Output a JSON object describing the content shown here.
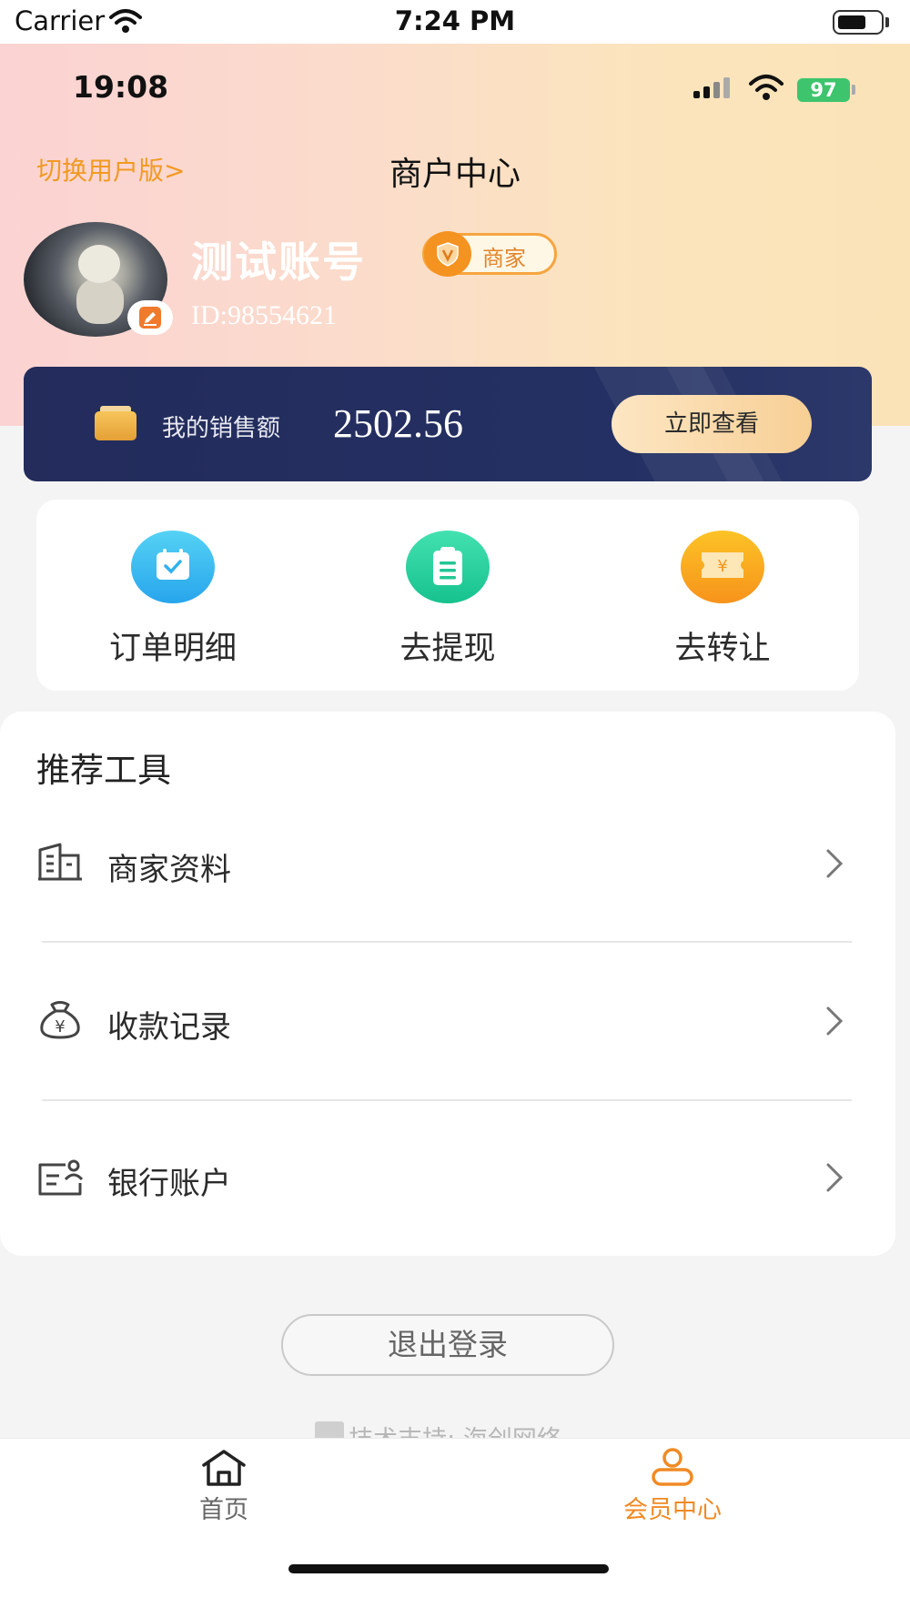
{
  "ios_status": {
    "carrier": "Carrier",
    "time": "7:24 PM"
  },
  "inner_status": {
    "time": "19:08",
    "battery": "97"
  },
  "header": {
    "switch_link": "切换用户版>",
    "title": "商户中心"
  },
  "profile": {
    "username": "测试账号",
    "user_id": "ID:98554621",
    "badge": "商家"
  },
  "sales": {
    "label": "我的销售额",
    "amount": "2502.56",
    "button": "立即查看"
  },
  "actions": [
    {
      "label": "订单明细",
      "icon": "order-calendar-icon",
      "color": "#27a5ec"
    },
    {
      "label": "去提现",
      "icon": "withdraw-clipboard-icon",
      "color": "#16c28e"
    },
    {
      "label": "去转让",
      "icon": "transfer-ticket-icon",
      "color": "#f7931b"
    }
  ],
  "tools": {
    "title": "推荐工具",
    "items": [
      {
        "label": "商家资料",
        "icon": "building-icon"
      },
      {
        "label": "收款记录",
        "icon": "money-bag-icon"
      },
      {
        "label": "银行账户",
        "icon": "bank-card-icon"
      }
    ]
  },
  "logout": "退出登录",
  "support": "技术支持: 海创网络",
  "bottom_nav": {
    "items": [
      {
        "label": "首页",
        "icon": "home-icon",
        "active": false
      },
      {
        "label": "会员中心",
        "icon": "member-icon",
        "active": true
      }
    ],
    "active_color": "#f08a24"
  },
  "colors": {
    "accent": "#f09a24",
    "card_navy": "#243063"
  }
}
